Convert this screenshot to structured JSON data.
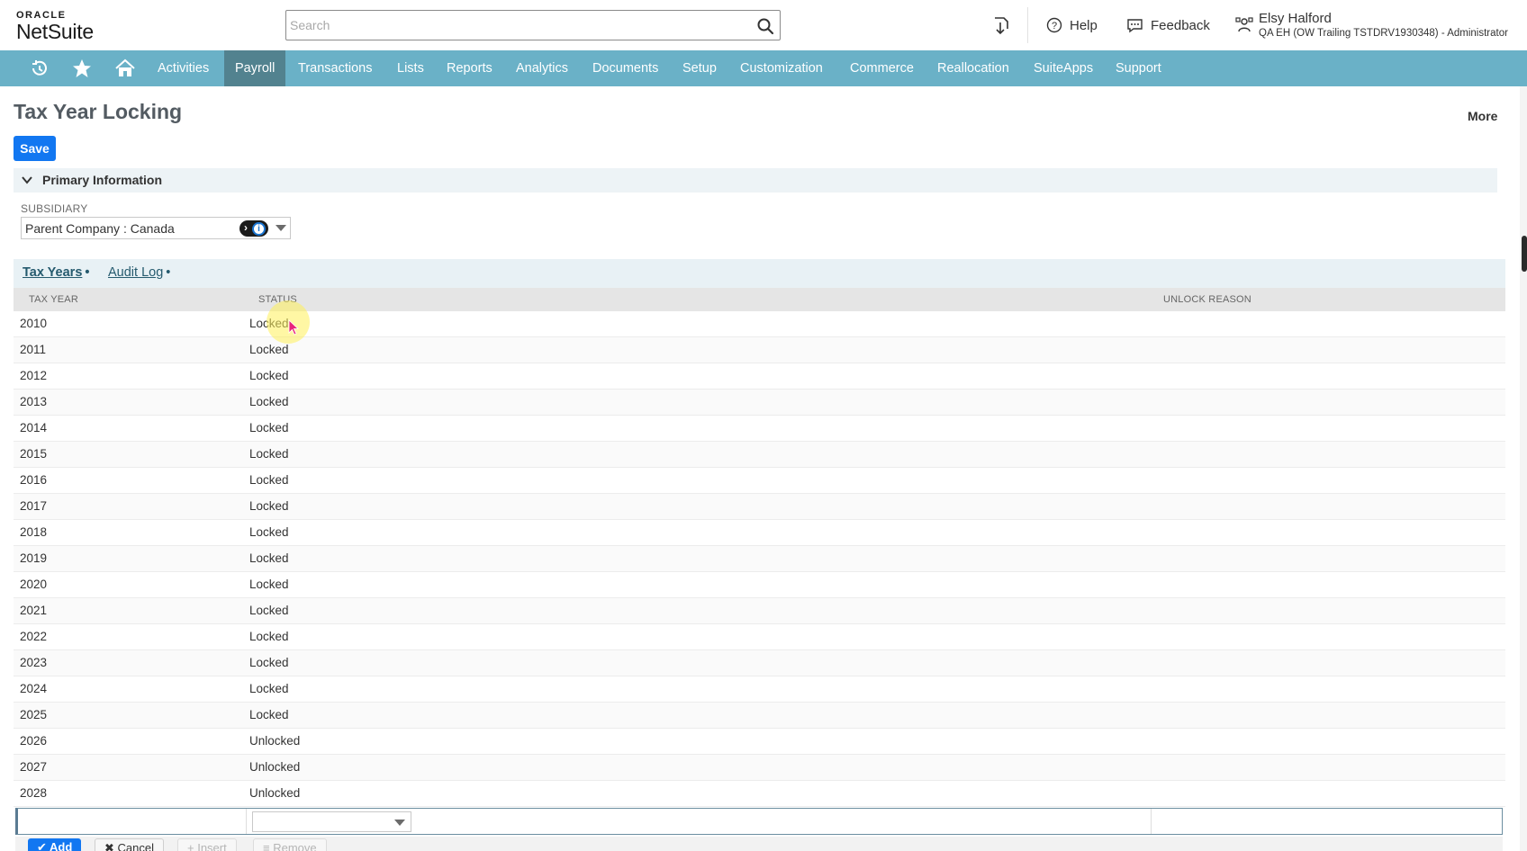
{
  "app": {
    "brand_top": "ORACLE",
    "brand_name": "NetSuite"
  },
  "header": {
    "search_placeholder": "Search",
    "help_label": "Help",
    "feedback_label": "Feedback",
    "user_name": "Elsy Halford",
    "user_role": "QA EH (OW Trailing TSTDRV1930348) - Administrator"
  },
  "nav": {
    "items": [
      "Activities",
      "Payroll",
      "Transactions",
      "Lists",
      "Reports",
      "Analytics",
      "Documents",
      "Setup",
      "Customization",
      "Commerce",
      "Reallocation",
      "SuiteApps",
      "Support"
    ],
    "active": "Payroll",
    "color": "#6ab1c7",
    "active_color": "#52828f"
  },
  "page": {
    "title": "Tax Year Locking",
    "more_label": "More",
    "save_label": "Save"
  },
  "primary_info": {
    "section_title": "Primary Information",
    "subsidiary_label": "SUBSIDIARY",
    "subsidiary_value": "Parent Company : Canada"
  },
  "tabs": [
    {
      "label": "Tax Years",
      "active": true
    },
    {
      "label": "Audit Log",
      "active": false
    }
  ],
  "grid": {
    "headers": {
      "tax_year": "TAX YEAR",
      "status": "STATUS",
      "unlock_reason": "UNLOCK REASON"
    },
    "rows": [
      {
        "year": "2010",
        "status": "Locked"
      },
      {
        "year": "2011",
        "status": "Locked"
      },
      {
        "year": "2012",
        "status": "Locked"
      },
      {
        "year": "2013",
        "status": "Locked"
      },
      {
        "year": "2014",
        "status": "Locked"
      },
      {
        "year": "2015",
        "status": "Locked"
      },
      {
        "year": "2016",
        "status": "Locked"
      },
      {
        "year": "2017",
        "status": "Locked"
      },
      {
        "year": "2018",
        "status": "Locked"
      },
      {
        "year": "2019",
        "status": "Locked"
      },
      {
        "year": "2020",
        "status": "Locked"
      },
      {
        "year": "2021",
        "status": "Locked"
      },
      {
        "year": "2022",
        "status": "Locked"
      },
      {
        "year": "2023",
        "status": "Locked"
      },
      {
        "year": "2024",
        "status": "Locked"
      },
      {
        "year": "2025",
        "status": "Locked"
      },
      {
        "year": "2026",
        "status": "Unlocked"
      },
      {
        "year": "2027",
        "status": "Unlocked"
      },
      {
        "year": "2028",
        "status": "Unlocked"
      }
    ]
  },
  "grid_buttons": {
    "add": "Add",
    "cancel": "Cancel",
    "insert": "Insert",
    "remove": "Remove"
  },
  "colors": {
    "primary_button": "#1277f1"
  }
}
